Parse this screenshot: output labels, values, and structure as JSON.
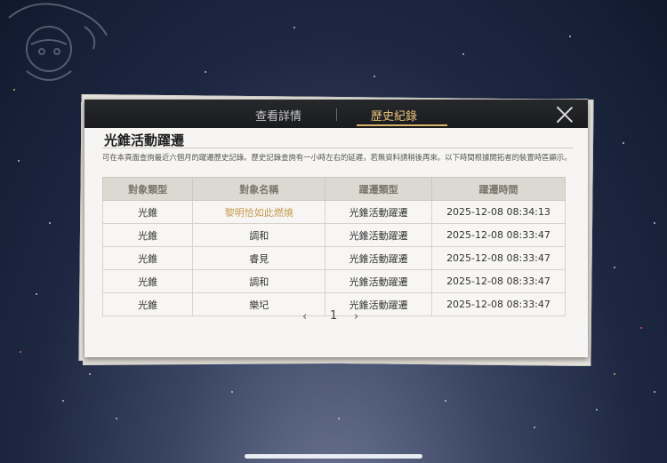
{
  "tabs": [
    {
      "label": "查看詳情",
      "active": false
    },
    {
      "label": "歷史紀錄",
      "active": true
    }
  ],
  "panel": {
    "title": "光錐活動躍遷",
    "description": "可在本頁面查詢最近六個月的躍遷歷史記錄。歷史記錄查詢有一小時左右的延遲，若無資料請稍後再來。以下時間根據開拓者的裝置時區顯示。"
  },
  "table": {
    "headers": [
      "對象類型",
      "對象名稱",
      "躍遷類型",
      "躍遷時間"
    ],
    "rows": [
      {
        "type": "光錐",
        "name": "黎明恰如此燃燒",
        "warp": "光錐活動躍遷",
        "time": "2025-12-08 08:34:13",
        "highlight": true
      },
      {
        "type": "光錐",
        "name": "調和",
        "warp": "光錐活動躍遷",
        "time": "2025-12-08 08:33:47",
        "highlight": false
      },
      {
        "type": "光錐",
        "name": "睿見",
        "warp": "光錐活動躍遷",
        "time": "2025-12-08 08:33:47",
        "highlight": false
      },
      {
        "type": "光錐",
        "name": "調和",
        "warp": "光錐活動躍遷",
        "time": "2025-12-08 08:33:47",
        "highlight": false
      },
      {
        "type": "光錐",
        "name": "樂圮",
        "warp": "光錐活動躍遷",
        "time": "2025-12-08 08:33:47",
        "highlight": false
      }
    ],
    "highlight_color": "#c59a4e"
  },
  "pager": {
    "prev_icon": "‹",
    "page": "1",
    "next_icon": "›"
  },
  "icons": {
    "close": "close-icon"
  }
}
